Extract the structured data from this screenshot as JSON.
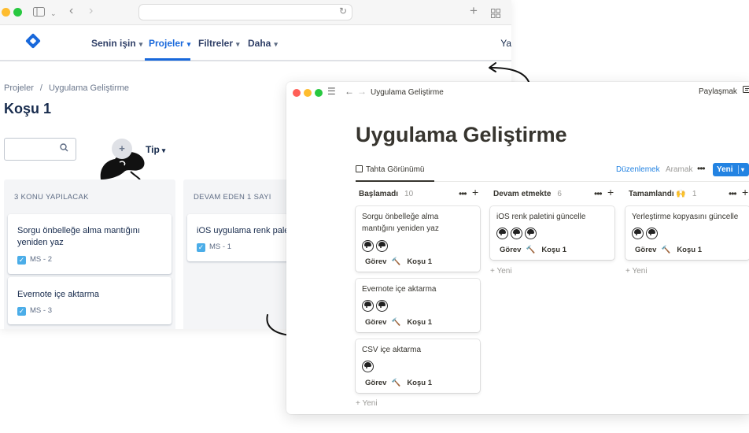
{
  "jira": {
    "nav": {
      "items": [
        {
          "label": "Senin işin"
        },
        {
          "label": "Projeler"
        },
        {
          "label": "Filtreler"
        },
        {
          "label": "Daha"
        }
      ],
      "cut_text": "Ya"
    },
    "breadcrumb": {
      "root": "Projeler",
      "sep": "/",
      "current": "Uygulama Geliştirme"
    },
    "title": "Koşu 1",
    "filter_label": "Tip",
    "columns": [
      {
        "header": "3 KONU YAPILACAK",
        "cards": [
          {
            "title": "Sorgu önbelleğe alma mantığını yeniden yaz",
            "key": "MS - 2"
          },
          {
            "title": "Evernote içe aktarma",
            "key": "MS - 3"
          }
        ]
      },
      {
        "header": "DEVAM EDEN 1 SAYI",
        "cards": [
          {
            "title": "iOS uygulama renk paleti",
            "key": "MS - 1"
          }
        ]
      }
    ]
  },
  "notion": {
    "breadcrumb": "Uygulama Geliştirme",
    "share_label": "Paylaşmak",
    "title": "Uygulama Geliştirme",
    "view_tab": "Tahta Görünümü",
    "edit_label": "Düzenlemek",
    "search_label": "Aramak",
    "new_button": "Yeni",
    "add_new": "+ Yeni",
    "columns": [
      {
        "name": "Başlamadı",
        "count": "10",
        "cards": [
          {
            "title": "Sorgu önbelleğe alma mantığını yeniden yaz",
            "type": "Görev",
            "sprint": "Koşu 1",
            "avatars": 2
          },
          {
            "title": "Evernote içe aktarma",
            "type": "Görev",
            "sprint": "Koşu 1",
            "avatars": 2
          },
          {
            "title": "CSV içe aktarma",
            "type": "Görev",
            "sprint": "Koşu 1",
            "avatars": 1
          }
        ]
      },
      {
        "name": "Devam etmekte",
        "count": "6",
        "cards": [
          {
            "title": "iOS renk paletini güncelle",
            "type": "Görev",
            "sprint": "Koşu 1",
            "avatars": 3
          }
        ]
      },
      {
        "name": "Tamamlandı 🙌",
        "count": "1",
        "cards": [
          {
            "title": "Yerleştirme kopyasını güncelle",
            "type": "Görev",
            "sprint": "Koşu 1",
            "avatars": 2
          }
        ]
      }
    ]
  },
  "colors": {
    "jira_blue": "#1868db",
    "notion_blue": "#2383e2",
    "traffic_red": "#ff5f57",
    "traffic_yellow": "#febc2e",
    "traffic_green": "#28c840"
  }
}
